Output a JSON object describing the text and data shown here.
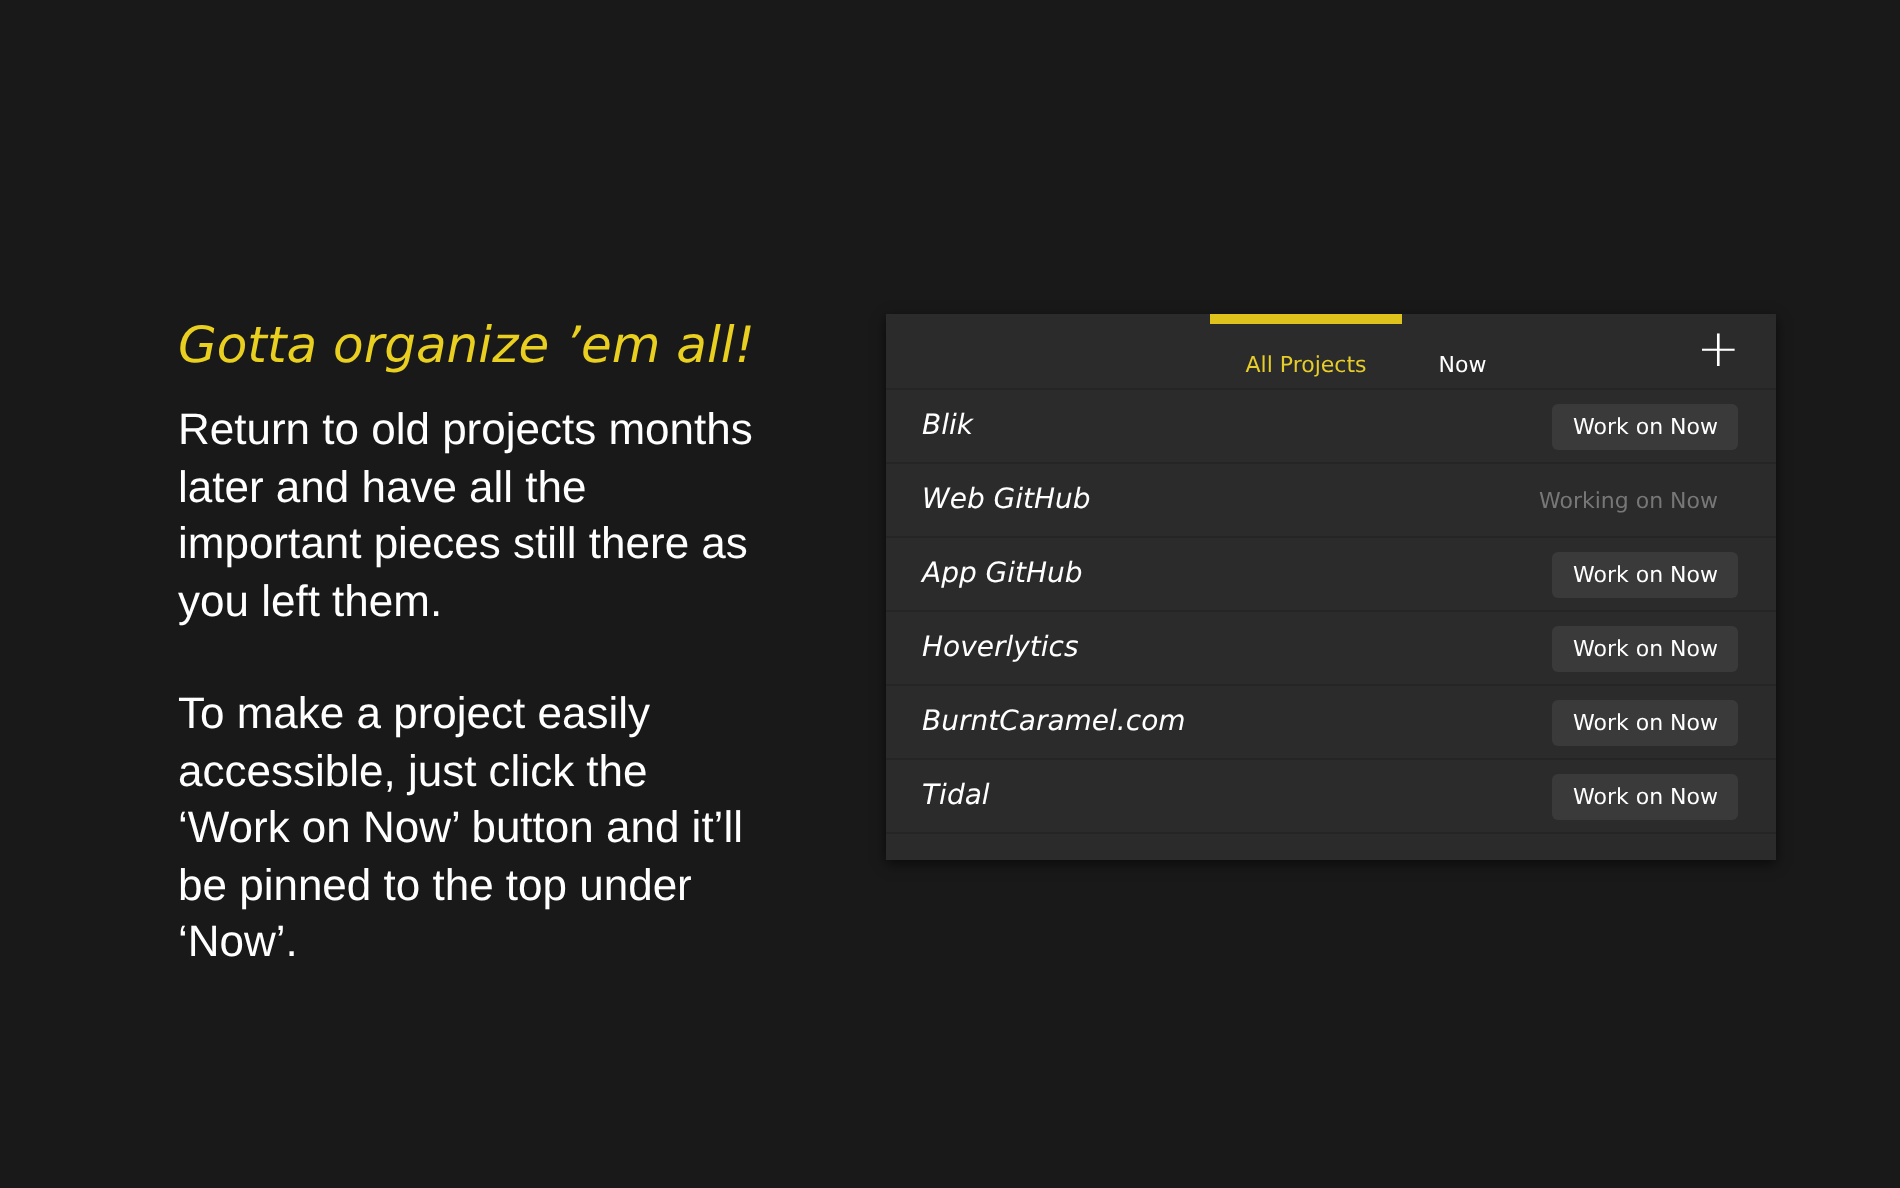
{
  "promo": {
    "heading": "Gotta organize ’em all!",
    "paragraphs": [
      "Return to old projects months later and have all the important pieces still there as you left them.",
      "To make a project easily accessible, just click the ‘Work on Now’ button and it’ll be pinned to the top under ‘Now’."
    ]
  },
  "app": {
    "tabs": [
      {
        "label": "All Projects",
        "selected": true
      },
      {
        "label": "Now",
        "selected": false
      }
    ],
    "add_button": "+",
    "projects": [
      {
        "name": "Blik",
        "working": false,
        "action": "Work on Now"
      },
      {
        "name": "Web GitHub",
        "working": true,
        "action": "Working on Now"
      },
      {
        "name": "App GitHub",
        "working": false,
        "action": "Work on Now"
      },
      {
        "name": "Hoverlytics",
        "working": false,
        "action": "Work on Now"
      },
      {
        "name": "BurntCaramel.com",
        "working": false,
        "action": "Work on Now"
      },
      {
        "name": "Tidal",
        "working": false,
        "action": "Work on Now"
      }
    ]
  }
}
